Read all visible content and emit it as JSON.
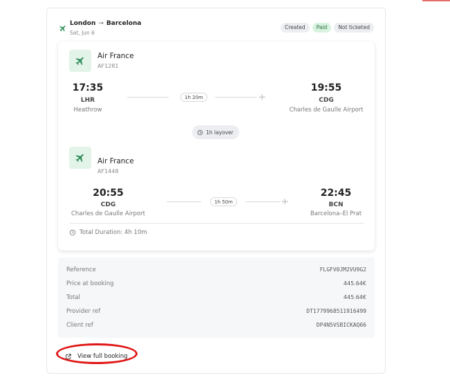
{
  "route": {
    "from": "London",
    "to": "Barcelona",
    "arrow": "→",
    "date": "Sat, Jun 6"
  },
  "badges": {
    "created": "Created",
    "paid": "Paid",
    "ticket_status": "Not ticketed"
  },
  "segments": [
    {
      "airline": "Air France",
      "flight_no": "AF1281",
      "dep_time": "17:35",
      "dep_code": "LHR",
      "dep_airport": "Heathrow",
      "duration": "1h 20m",
      "arr_time": "19:55",
      "arr_code": "CDG",
      "arr_airport": "Charles de Gaulle Airport"
    },
    {
      "airline": "Air France",
      "flight_no": "AF1448",
      "dep_time": "20:55",
      "dep_code": "CDG",
      "dep_airport": "Charles de Gaulle Airport",
      "duration": "1h 50m",
      "arr_time": "22:45",
      "arr_code": "BCN",
      "arr_airport": "Barcelona–El Prat"
    }
  ],
  "layover": "1h layover",
  "total_duration": "Total Duration: 4h 10m",
  "details": [
    {
      "label": "Reference",
      "value": "FLGFV0JM2VU9G2"
    },
    {
      "label": "Price at booking",
      "value": "445.64€"
    },
    {
      "label": "Total",
      "value": "445.64€"
    },
    {
      "label": "Provider ref",
      "value": "DT1779968511916499"
    },
    {
      "label": "Client ref",
      "value": "DP4N5VSBICKAQ66"
    }
  ],
  "view_button": "View full booking",
  "colors": {
    "brand_green": "#2e8b57",
    "paid_badge_bg": "#d8f3e0",
    "highlight": "#e01515"
  },
  "icons": {
    "route": "plane-icon",
    "airline": "airline-plane-icon",
    "arrival": "plane-icon",
    "layover": "clock-icon",
    "duration": "clock-icon",
    "view": "external-link-icon"
  }
}
